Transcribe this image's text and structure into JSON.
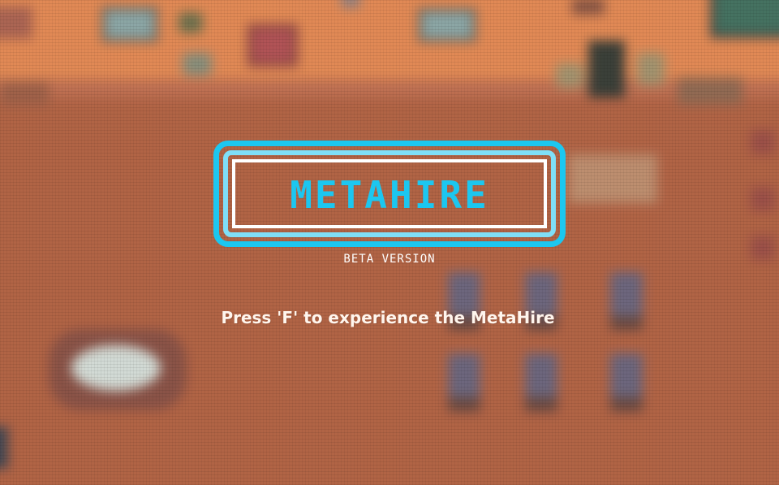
{
  "title_screen": {
    "logo_text": "METAHIRE",
    "subtitle": "BETA VERSION",
    "prompt": "Press 'F' to experience the MetaHire"
  },
  "colors": {
    "logo_accent": "#1cc7f0",
    "logo_light": "#7fdff7",
    "frame_inner": "#ffffff",
    "wall": "#f0955d",
    "floor": "#b96a4b"
  }
}
